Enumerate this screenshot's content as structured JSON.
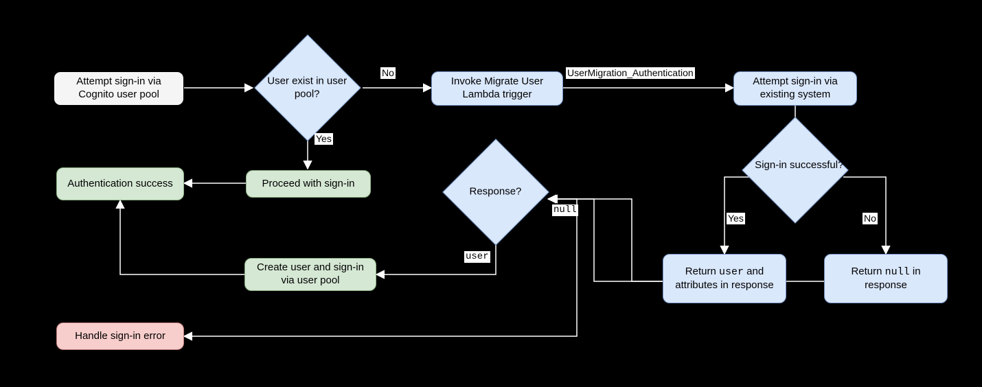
{
  "nodes": {
    "attempt_cognito": "Attempt sign-in\nvia Cognito user pool",
    "user_exist": "User exist in\nuser pool?",
    "invoke_lambda": "Invoke Migrate User\nLambda trigger",
    "attempt_existing": "Attempt sign-in via\nexisting system",
    "auth_success": "Authentication\nsuccess",
    "proceed_signin": "Proceed with sign-in",
    "response": "Response?",
    "signin_successful": "Sign-in\nsuccessful?",
    "create_user": "Create user and sign-in\nvia user pool",
    "return_user_pre": "Return ",
    "return_user_code": "user",
    "return_user_post": " and attributes in response",
    "return_null_pre": "Return ",
    "return_null_code": "null",
    "return_null_post": " in response",
    "handle_error": "Handle sign-in error"
  },
  "edges": {
    "user_exist_no": "No",
    "user_exist_yes": "Yes",
    "trigger_event": "UserMigration_Authentication",
    "response_null": "null",
    "response_user": "user",
    "signin_yes": "Yes",
    "signin_no": "No"
  }
}
